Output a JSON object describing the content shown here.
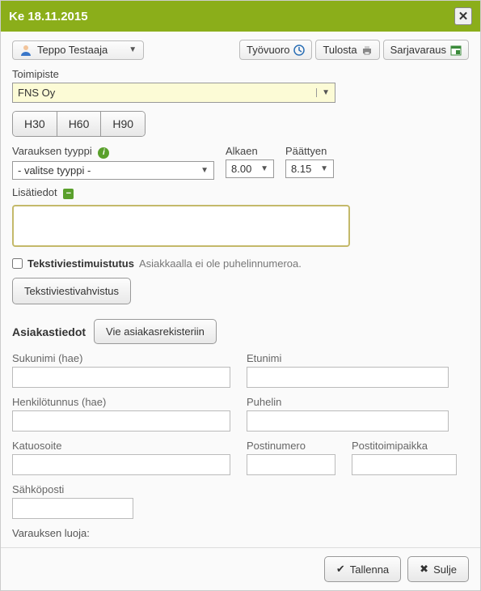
{
  "title": "Ke 18.11.2015",
  "person": "Teppo Testaaja",
  "top_buttons": {
    "tyovuoro": "Työvuoro",
    "tulosta": "Tulosta",
    "sarjavaraus": "Sarjavaraus"
  },
  "toimipiste": {
    "label": "Toimipiste",
    "value": "FNS Oy"
  },
  "durations": [
    "H30",
    "H60",
    "H90"
  ],
  "varauksen_tyyppi": {
    "label": "Varauksen tyyppi",
    "value": "- valitse tyyppi -"
  },
  "alkaen": {
    "label": "Alkaen",
    "value": "8.00"
  },
  "paattyen": {
    "label": "Päättyen",
    "value": "8.15"
  },
  "lisatiedot": {
    "label": "Lisätiedot",
    "value": ""
  },
  "sms_reminder_label": "Tekstiviestimuistutus",
  "sms_reminder_note": "Asiakkaalla ei ole puhelinnumeroa.",
  "sms_confirm_button": "Tekstiviestivahvistus",
  "asiakastiedot_heading": "Asiakastiedot",
  "vie_button": "Vie asiakasrekisteriin",
  "fields": {
    "sukunimi": {
      "label": "Sukunimi (hae)",
      "value": ""
    },
    "etunimi": {
      "label": "Etunimi",
      "value": ""
    },
    "henkilotunnus": {
      "label": "Henkilötunnus (hae)",
      "value": ""
    },
    "puhelin": {
      "label": "Puhelin",
      "value": ""
    },
    "katuosoite": {
      "label": "Katuosoite",
      "value": ""
    },
    "postinumero": {
      "label": "Postinumero",
      "value": ""
    },
    "postitoimipaikka": {
      "label": "Postitoimipaikka",
      "value": ""
    },
    "sahkoposti": {
      "label": "Sähköposti",
      "value": ""
    }
  },
  "varauksen_luoja": "Varauksen luoja:",
  "footer": {
    "tallenna": "Tallenna",
    "sulje": "Sulje"
  }
}
